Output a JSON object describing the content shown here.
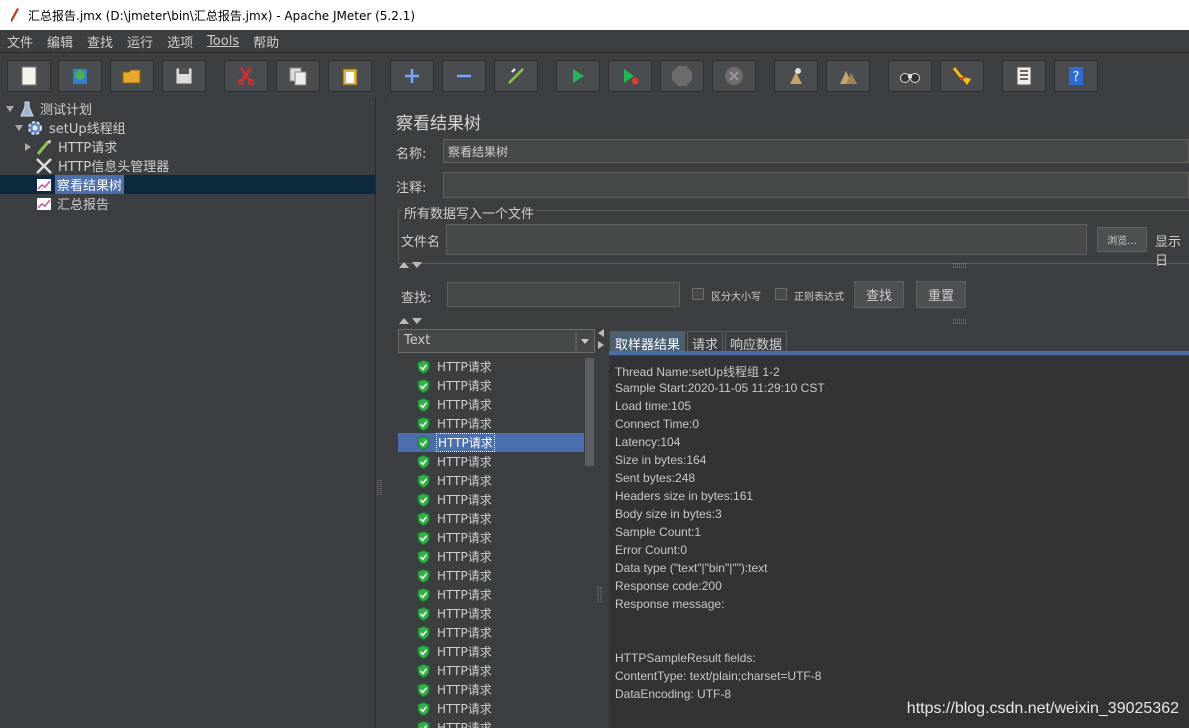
{
  "window": {
    "title": "汇总报告.jmx (D:\\jmeter\\bin\\汇总报告.jmx) - Apache JMeter (5.2.1)"
  },
  "menu": [
    "文件",
    "编辑",
    "查找",
    "运行",
    "选项",
    "Tools",
    "帮助"
  ],
  "toolbar": {
    "buttons": [
      "new-icon",
      "templates-icon",
      "open-icon",
      "save-icon",
      "cut-icon",
      "copy-icon",
      "paste-icon",
      "expand-icon",
      "collapse-icon",
      "toggle-icon",
      "start-icon",
      "start-no-pause-icon",
      "stop-icon",
      "shutdown-icon",
      "clear-icon",
      "clear-all-icon",
      "search-icon",
      "reset-search-icon",
      "function-helper-icon",
      "help-icon"
    ]
  },
  "tree": {
    "items": [
      {
        "label": "测试计划",
        "icon": "flask-icon"
      },
      {
        "label": "setUp线程组",
        "icon": "gear-icon"
      },
      {
        "label": "HTTP请求",
        "icon": "pipette-icon"
      },
      {
        "label": "HTTP信息头管理器",
        "icon": "wrench-icon"
      },
      {
        "label": "察看结果树",
        "icon": "graph-icon"
      },
      {
        "label": "汇总报告",
        "icon": "graph-icon"
      }
    ]
  },
  "panel": {
    "title": "察看结果树",
    "name_label": "名称:",
    "name_value": "察看结果树",
    "comment_label": "注释:",
    "file_group_label": "所有数据写入一个文件",
    "file_label": "文件名",
    "browse_button": "浏览...",
    "show_label": "显示日",
    "search_label": "查找:",
    "case_label": "区分大小写",
    "regex_label": "正则表达式",
    "find_button": "查找",
    "reset_button": "重置",
    "renderer_value": "Text"
  },
  "results": {
    "item_label": "HTTP请求",
    "count": 20,
    "selected_index": 4
  },
  "tabs": [
    "取样器结果",
    "请求",
    "响应数据"
  ],
  "sampler_result": [
    "Thread Name:setUp线程组 1-2",
    "Sample Start:2020-11-05 11:29:10 CST",
    "Load time:105",
    "Connect Time:0",
    "Latency:104",
    "Size in bytes:164",
    "Sent bytes:248",
    "Headers size in bytes:161",
    "Body size in bytes:3",
    "Sample Count:1",
    "Error Count:0",
    "Data type (\"text\"|\"bin\"|\"\"):text",
    "Response code:200",
    "Response message:",
    "",
    "",
    "HTTPSampleResult fields:",
    "ContentType: text/plain;charset=UTF-8",
    "DataEncoding: UTF-8"
  ],
  "watermark": "https://blog.csdn.net/weixin_39025362"
}
